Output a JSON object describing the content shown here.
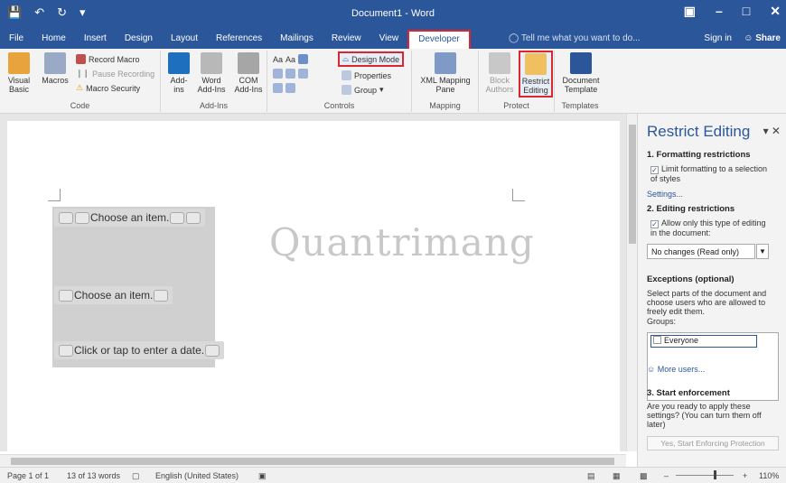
{
  "titlebar": {
    "title": "Document1 - Word",
    "qat": [
      "save-icon",
      "undo-icon",
      "redo-icon",
      "customize-icon"
    ],
    "controls": [
      "ribbon-display-icon",
      "minimize-icon",
      "restore-icon",
      "close-icon"
    ],
    "accent": "#2b579a"
  },
  "tabs": [
    "File",
    "Home",
    "Insert",
    "Design",
    "Layout",
    "References",
    "Mailings",
    "Review",
    "View",
    "Developer"
  ],
  "active_tab": "Developer",
  "tellme": "Tell me what you want to do...",
  "signin": "Sign in",
  "share": "Share",
  "ribbon": {
    "code": {
      "label": "Code",
      "visual_basic": "Visual Basic",
      "macros": "Macros",
      "record_macro": "Record Macro",
      "pause_recording": "Pause Recording",
      "macro_security": "Macro Security"
    },
    "addins": {
      "label": "Add-Ins",
      "addins": "Add-ins",
      "word_addins": "Word Add-Ins",
      "com_addins": "COM Add-Ins"
    },
    "controls": {
      "label": "Controls",
      "design_mode": "Design Mode",
      "properties": "Properties",
      "group": "Group"
    },
    "mapping": {
      "label": "Mapping",
      "xml_mapping_pane": "XML Mapping Pane"
    },
    "protect": {
      "label": "Protect",
      "block_authors": "Block Authors",
      "restrict_editing": "Restrict Editing"
    },
    "templates": {
      "label": "Templates",
      "document_template": "Document Template"
    }
  },
  "document": {
    "controls": [
      "Choose an item.",
      "Choose an item.",
      "Click or tap to enter a date."
    ],
    "watermark": "Quantrimang"
  },
  "pane": {
    "title": "Restrict Editing",
    "formatting_heading": "1. Formatting restrictions",
    "formatting_check": "Limit formatting to a selection of styles",
    "settings_link": "Settings...",
    "editing_heading": "2. Editing restrictions",
    "editing_check": "Allow only this type of editing in the document:",
    "editing_select": "No changes (Read only)",
    "exceptions_heading": "Exceptions (optional)",
    "exceptions_desc": "Select parts of the document and choose users who are allowed to freely edit them.",
    "groups_label": "Groups:",
    "everyone": "Everyone",
    "more_users": "More users...",
    "enforcement_heading": "3. Start enforcement",
    "enforcement_desc": "Are you ready to apply these settings? (You can turn them off later)",
    "start_button": "Yes, Start Enforcing Protection"
  },
  "status": {
    "page": "Page 1 of 1",
    "words": "13 of 13 words",
    "language": "English (United States)",
    "zoom": "110%"
  }
}
